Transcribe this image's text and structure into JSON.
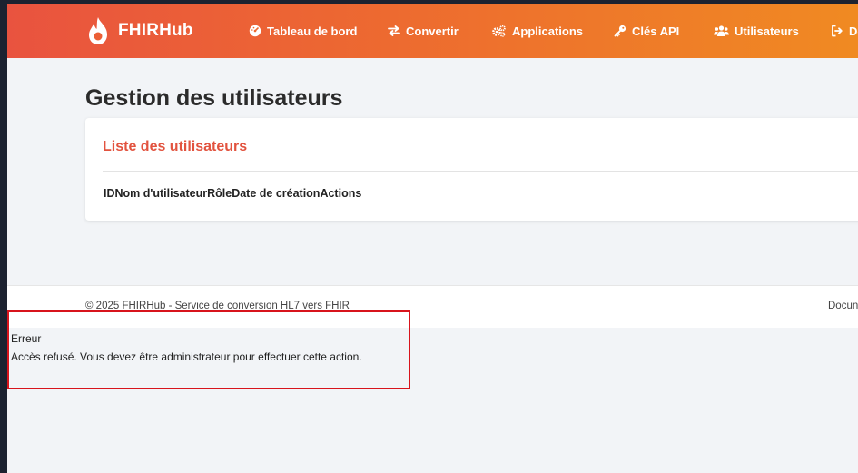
{
  "navbar": {
    "brand": "FHIRHub",
    "items": [
      {
        "label": "Tableau de bord",
        "icon": "dashboard-icon"
      },
      {
        "label": "Convertir",
        "icon": "exchange-icon"
      },
      {
        "label": "Applications",
        "icon": "cogs-icon"
      },
      {
        "label": "Clés API",
        "icon": "key-icon"
      },
      {
        "label": "Utilisateurs",
        "icon": "users-icon"
      },
      {
        "label": "Dé",
        "icon": "logout-icon"
      }
    ]
  },
  "page": {
    "title": "Gestion des utilisateurs"
  },
  "card": {
    "title": "Liste des utilisateurs",
    "columns": [
      "ID",
      "Nom d'utilisateur",
      "Rôle",
      "Date de création",
      "Actions"
    ]
  },
  "footer": {
    "copyright": "© 2025 FHIRHub - Service de conversion HL7 vers FHIR",
    "link": "Docun"
  },
  "error": {
    "title": "Erreur",
    "message": "Accès refusé. Vous devez être administrateur pour effectuer cette action."
  },
  "colors": {
    "gradient_start": "#e9533f",
    "gradient_end": "#f08a22",
    "accent": "#e2533f",
    "error_border": "#d8141c"
  }
}
